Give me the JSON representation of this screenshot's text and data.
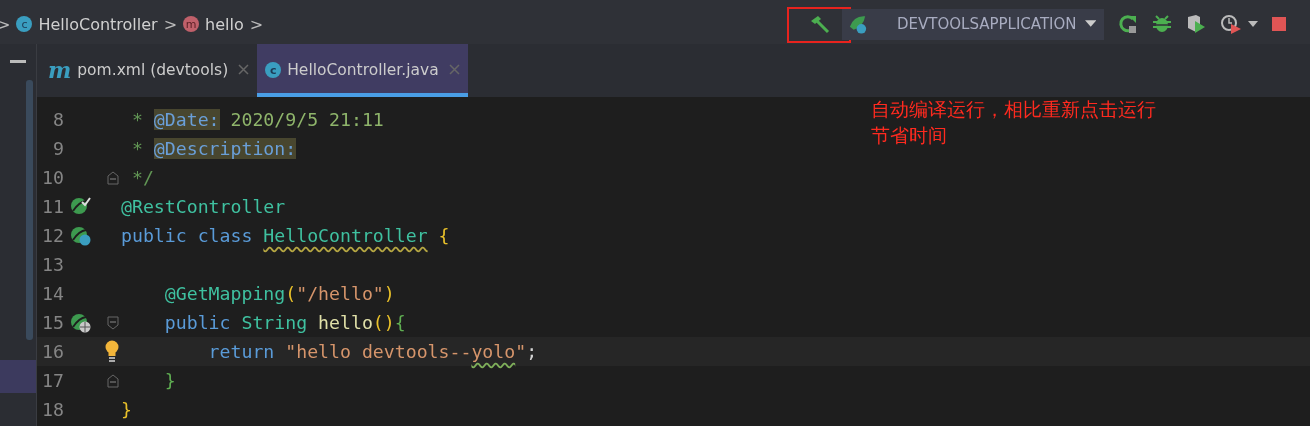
{
  "breadcrumbs": [
    {
      "kind": "separator",
      "text": ">"
    },
    {
      "kind": "class",
      "badge": "c",
      "text": "HelloController"
    },
    {
      "kind": "separator",
      "text": ">"
    },
    {
      "kind": "method",
      "badge": "m",
      "text": "hello"
    },
    {
      "kind": "separator",
      "text": ">"
    }
  ],
  "toolbar": {
    "run_config": "DEVTOOLSAPPLICATION"
  },
  "tabs": [
    {
      "icon": "m",
      "kind": "maven",
      "label": "pom.xml (devtools)",
      "selected": false
    },
    {
      "icon": "c",
      "kind": "class",
      "label": "HelloController.java",
      "selected": true
    }
  ],
  "editor": {
    "lines": [
      {
        "number": "8",
        "tokens": [
          {
            "text": " * ",
            "kind": "comment"
          },
          {
            "text": "@Date:",
            "kind": "doctag"
          },
          {
            "text": " 2020/9/5 21:11",
            "kind": "docvalue"
          }
        ]
      },
      {
        "number": "9",
        "tokens": [
          {
            "text": " * ",
            "kind": "comment"
          },
          {
            "text": "@Description:",
            "kind": "doctag"
          }
        ]
      },
      {
        "number": "10",
        "fold": {
          "kind": "end"
        },
        "tokens": [
          {
            "text": " */",
            "kind": "comment"
          }
        ]
      },
      {
        "number": "11",
        "marker": {
          "kind": "bean-check"
        },
        "tokens": [
          {
            "text": "@RestController",
            "kind": "annotation"
          }
        ]
      },
      {
        "number": "12",
        "marker": {
          "kind": "bean-class"
        },
        "tokens": [
          {
            "text": "public class ",
            "kind": "keyword"
          },
          {
            "text": "HelloController",
            "kind": "type",
            "warning": true
          },
          {
            "text": " {",
            "kind": "brace"
          }
        ]
      },
      {
        "number": "13"
      },
      {
        "number": "14",
        "tokens": [
          {
            "text": "    @GetMapping",
            "kind": "annotation"
          },
          {
            "text": "(",
            "kind": "brace"
          },
          {
            "text": "\"/hello\"",
            "kind": "string"
          },
          {
            "text": ")",
            "kind": "brace"
          }
        ]
      },
      {
        "number": "15",
        "marker": {
          "kind": "bean-web"
        },
        "fold": {
          "kind": "start"
        },
        "tokens": [
          {
            "text": "    public ",
            "kind": "keyword"
          },
          {
            "text": "String ",
            "kind": "type"
          },
          {
            "text": "hello",
            "kind": "method"
          },
          {
            "text": "()",
            "kind": "brace"
          },
          {
            "text": "{",
            "kind": "brace2"
          }
        ]
      },
      {
        "number": "16",
        "bulb": true,
        "current": true,
        "tokens": [
          {
            "text": "        return ",
            "kind": "keyword"
          },
          {
            "text": "\"hello devtools--",
            "kind": "string"
          },
          {
            "text": "yolo",
            "kind": "string",
            "warning": true
          },
          {
            "text": "\"",
            "kind": "string"
          },
          {
            "text": ";",
            "kind": "plain"
          }
        ]
      },
      {
        "number": "17",
        "fold": {
          "kind": "end"
        },
        "tokens": [
          {
            "text": "    }",
            "kind": "brace2"
          }
        ]
      },
      {
        "number": "18",
        "tokens": [
          {
            "text": "}",
            "kind": "brace"
          }
        ]
      }
    ]
  },
  "annotation": {
    "lines": [
      "自动编译运行，相比重新点击运行",
      "节省时间"
    ]
  }
}
